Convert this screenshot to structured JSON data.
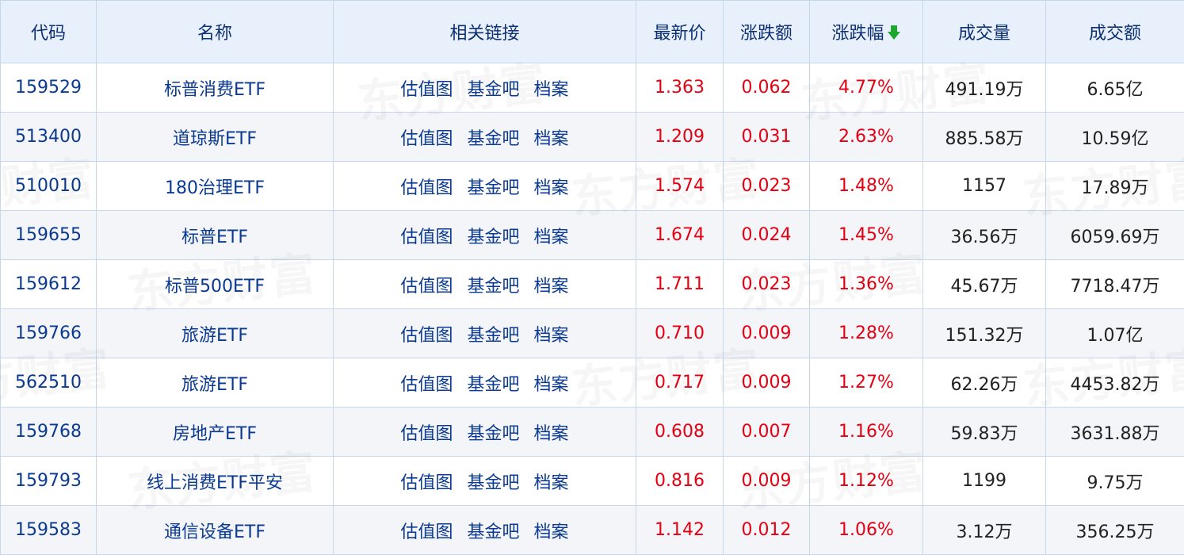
{
  "watermark": "东方财富",
  "headers": {
    "code": "代码",
    "name": "名称",
    "links": "相关链接",
    "price": "最新价",
    "change": "涨跌额",
    "change_pct": "涨跌幅",
    "volume": "成交量",
    "amount": "成交额"
  },
  "sort": {
    "column": "change_pct",
    "direction": "descending",
    "icon": "arrow-down-icon",
    "color": "#1ea62f"
  },
  "colors": {
    "header_bg": "#e8f1fb",
    "border": "#c6d7ec",
    "link_blue": "#0b3a92",
    "rise_red": "#e60012",
    "alt_row_bg": "#f0f2f6"
  },
  "link_labels": {
    "valuation": "估值图",
    "forum": "基金吧",
    "archive": "档案"
  },
  "rows": [
    {
      "code": "159529",
      "name": "标普消费ETF",
      "price": "1.363",
      "change": "0.062",
      "change_pct": "4.77%",
      "volume": "491.19万",
      "amount": "6.65亿"
    },
    {
      "code": "513400",
      "name": "道琼斯ETF",
      "price": "1.209",
      "change": "0.031",
      "change_pct": "2.63%",
      "volume": "885.58万",
      "amount": "10.59亿"
    },
    {
      "code": "510010",
      "name": "180治理ETF",
      "price": "1.574",
      "change": "0.023",
      "change_pct": "1.48%",
      "volume": "1157",
      "amount": "17.89万"
    },
    {
      "code": "159655",
      "name": "标普ETF",
      "price": "1.674",
      "change": "0.024",
      "change_pct": "1.45%",
      "volume": "36.56万",
      "amount": "6059.69万"
    },
    {
      "code": "159612",
      "name": "标普500ETF",
      "price": "1.711",
      "change": "0.023",
      "change_pct": "1.36%",
      "volume": "45.67万",
      "amount": "7718.47万"
    },
    {
      "code": "159766",
      "name": "旅游ETF",
      "price": "0.710",
      "change": "0.009",
      "change_pct": "1.28%",
      "volume": "151.32万",
      "amount": "1.07亿"
    },
    {
      "code": "562510",
      "name": "旅游ETF",
      "price": "0.717",
      "change": "0.009",
      "change_pct": "1.27%",
      "volume": "62.26万",
      "amount": "4453.82万"
    },
    {
      "code": "159768",
      "name": "房地产ETF",
      "price": "0.608",
      "change": "0.007",
      "change_pct": "1.16%",
      "volume": "59.83万",
      "amount": "3631.88万"
    },
    {
      "code": "159793",
      "name": "线上消费ETF平安",
      "price": "0.816",
      "change": "0.009",
      "change_pct": "1.12%",
      "volume": "1199",
      "amount": "9.75万"
    },
    {
      "code": "159583",
      "name": "通信设备ETF",
      "price": "1.142",
      "change": "0.012",
      "change_pct": "1.06%",
      "volume": "3.12万",
      "amount": "356.25万"
    }
  ]
}
